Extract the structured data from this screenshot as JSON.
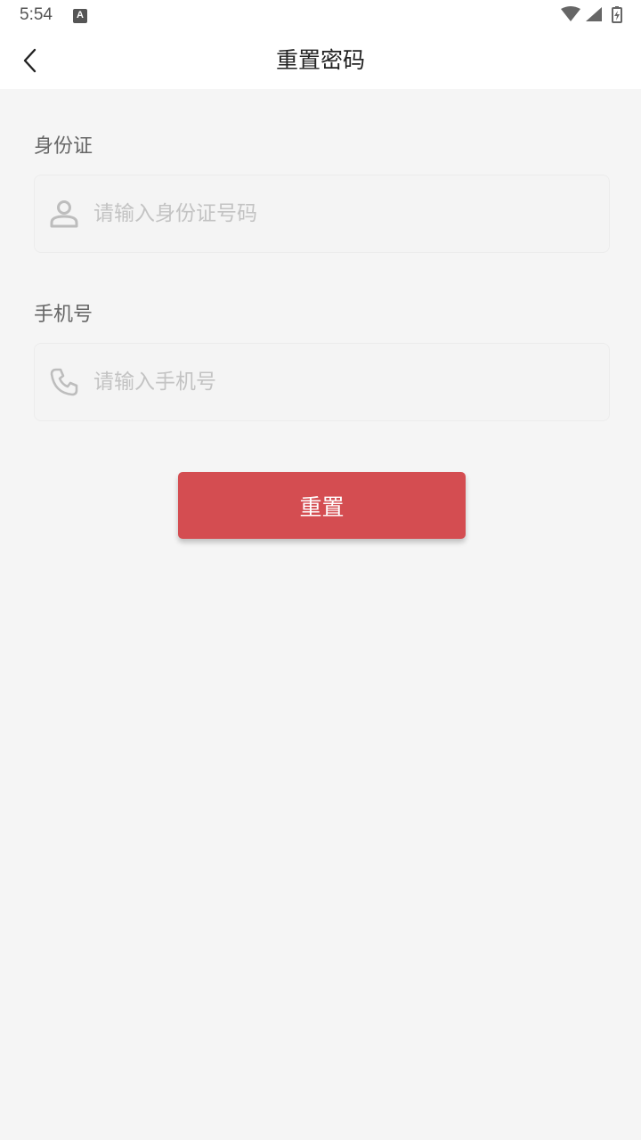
{
  "status_bar": {
    "time": "5:54",
    "notification_icon": "a-icon",
    "icons": [
      "wifi-icon",
      "cellular-signal-icon",
      "battery-charging-icon"
    ]
  },
  "header": {
    "title": "重置密码",
    "back_icon": "chevron-left-icon"
  },
  "form": {
    "id_card": {
      "label": "身份证",
      "placeholder": "请输入身份证号码",
      "value": "",
      "icon": "person-icon"
    },
    "phone": {
      "label": "手机号",
      "placeholder": "请输入手机号",
      "value": "",
      "icon": "phone-icon"
    },
    "submit_label": "重置"
  },
  "colors": {
    "accent": "#d44d51",
    "background": "#f5f5f5",
    "placeholder": "#c3c3c3"
  }
}
